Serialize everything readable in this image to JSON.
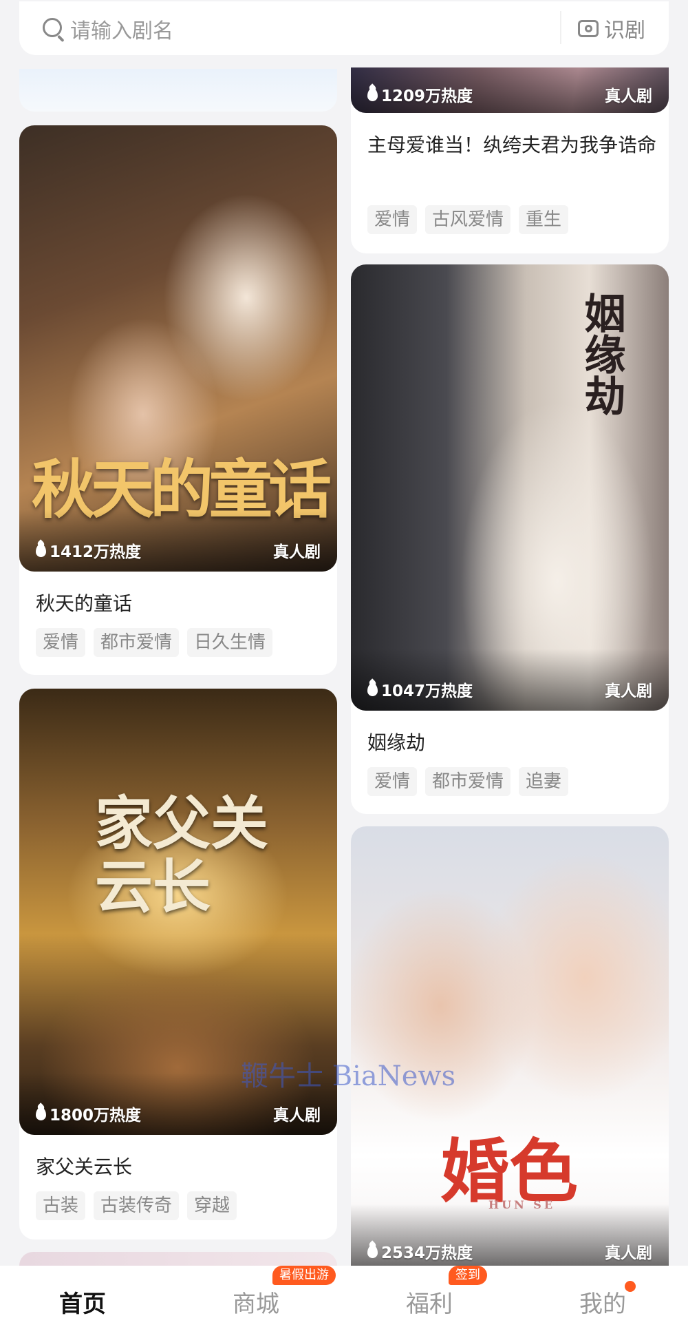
{
  "search": {
    "placeholder": "请输入剧名",
    "camera_label": "识剧"
  },
  "cards": [
    {
      "title": "主母爱谁当！纨绔夫君为我争诰命",
      "heat": "1209万热度",
      "badge": "真人剧",
      "tags": [
        "爱情",
        "古风爱情",
        "重生"
      ]
    },
    {
      "title": "秋天的童话",
      "heat": "1412万热度",
      "badge": "真人剧",
      "tags": [
        "爱情",
        "都市爱情",
        "日久生情"
      ],
      "poster_text": "秋天的童话"
    },
    {
      "title": "姻缘劫",
      "heat": "1047万热度",
      "badge": "真人剧",
      "tags": [
        "爱情",
        "都市爱情",
        "追妻"
      ],
      "poster_text": "姻缘劫"
    },
    {
      "title": "家父关云长",
      "heat": "1800万热度",
      "badge": "真人剧",
      "tags": [
        "古装",
        "古装传奇",
        "穿越"
      ],
      "poster_text": "家父关云长"
    },
    {
      "heat": "2534万热度",
      "badge": "真人剧",
      "poster_text": "婚色",
      "poster_subtext": "HUN SE"
    }
  ],
  "nav": {
    "items": [
      "首页",
      "商城",
      "福利",
      "我的"
    ],
    "badges": {
      "shop": "暑假出游",
      "welfare": "签到"
    }
  },
  "watermark": "鞭牛士 BiaNews",
  "colors": {
    "accent": "#ff5a1f",
    "background": "#f3f3f5"
  }
}
